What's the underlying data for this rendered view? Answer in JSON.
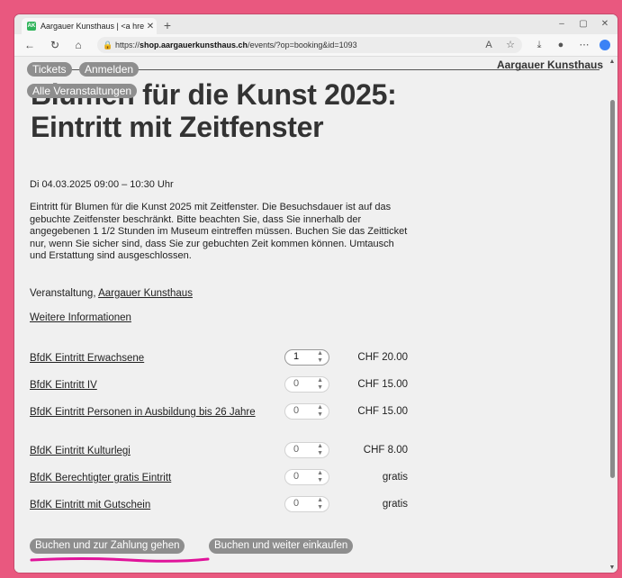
{
  "browser": {
    "tab_title": "Aargauer Kunsthaus | <a href=\"h",
    "favicon_text": "AK",
    "url_prefix": "https://",
    "url_host": "shop.aargauerkunsthaus.ch",
    "url_path": "/events/?op=booking&id=1093"
  },
  "nav": {
    "tickets_label": "Tickets",
    "login_label": "Anmelden",
    "all_events_label": "Alle Veranstaltungen",
    "brand": "Aargauer Kunsthaus"
  },
  "event": {
    "title_line1": "Blumen für die Kunst 2025:",
    "title_line2": "Eintritt mit Zeitfenster",
    "date": "Di 04.03.2025 09:00 – 10:30 Uhr",
    "description": "Eintritt für Blumen für die Kunst 2025 mit Zeitfenster. Die Besuchsdauer ist auf das gebuchte Zeitfenster beschränkt. Bitte beachten Sie, dass Sie innerhalb der angegebenen 1 1/2 Stunden im Museum eintreffen müssen. Buchen Sie das Zeitticket nur, wenn Sie sicher sind, dass Sie zur gebuchten Zeit kommen können. Umtausch und Erstattung sind ausgeschlossen.",
    "organizer_prefix": "Veranstaltung,",
    "organizer_link": "Aargauer Kunsthaus",
    "more_info": "Weitere Informationen"
  },
  "tickets": [
    {
      "name": "BfdK Eintritt Erwachsene",
      "qty": "1",
      "price": "CHF 20.00"
    },
    {
      "name": "BfdK Eintritt IV",
      "qty": "0",
      "price": "CHF 15.00"
    },
    {
      "name": "BfdK Eintritt Personen in Ausbildung bis 26 Jahre",
      "qty": "0",
      "price": "CHF 15.00"
    },
    {
      "name": "BfdK Eintritt Kulturlegi",
      "qty": "0",
      "price": "CHF 8.00"
    },
    {
      "name": "BfdK Berechtigter gratis Eintritt",
      "qty": "0",
      "price": "gratis"
    },
    {
      "name": "BfdK Eintritt mit Gutschein",
      "qty": "0",
      "price": "gratis"
    }
  ],
  "actions": {
    "book_pay": "Buchen und zur Zahlung gehen",
    "book_continue": "Buchen und weiter einkaufen"
  },
  "colors": {
    "background": "#e9587f",
    "pill": "#8e8e8e",
    "annotation": "#e0139a"
  }
}
